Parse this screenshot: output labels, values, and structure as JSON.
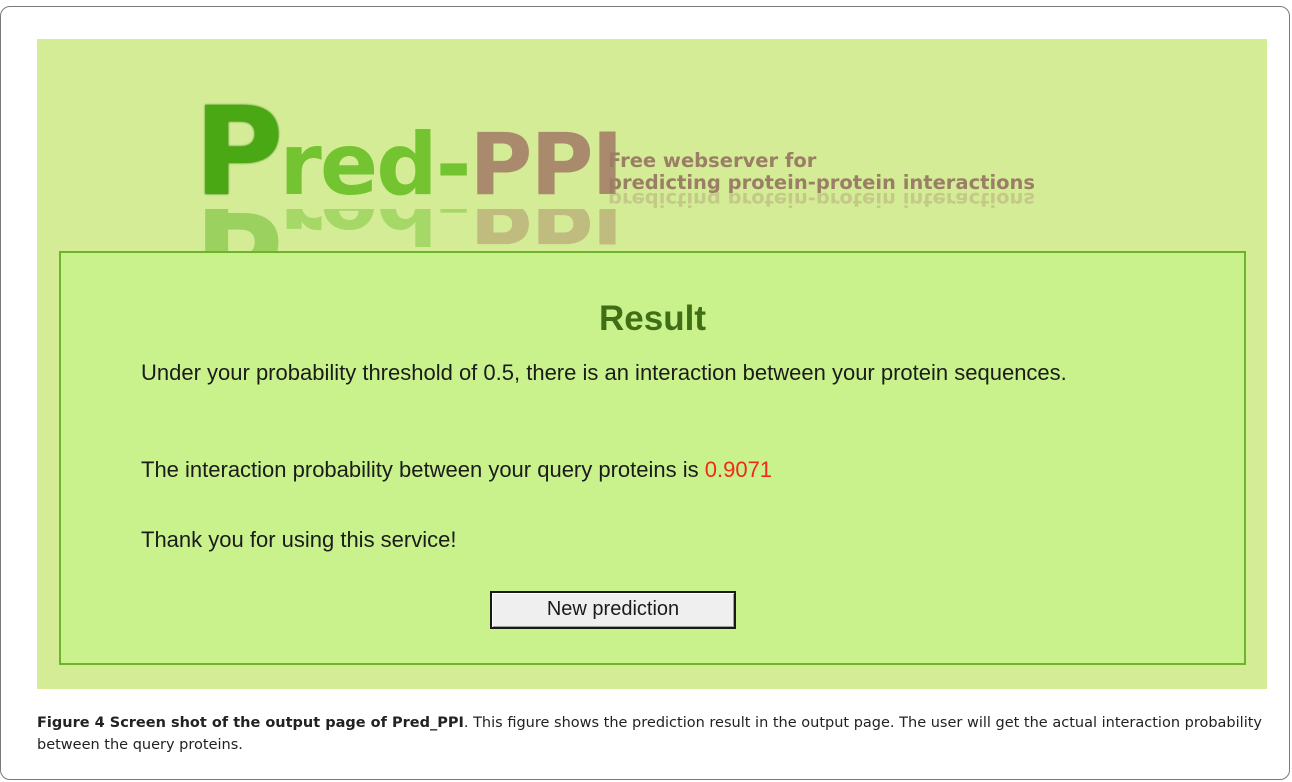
{
  "logo": {
    "p_letter": "P",
    "green_part": "red-",
    "brown_part": "PPI",
    "tagline_line1": "Free webserver for",
    "tagline_line2": "predicting protein-protein interactions"
  },
  "result": {
    "title": "Result",
    "threshold_message": "Under your probability threshold of 0.5, there is an interaction between your protein sequences.",
    "probability_prefix": "The interaction probability between your query proteins is ",
    "probability_value": "0.9071",
    "thanks_message": "Thank you for using this service!",
    "new_prediction_label": "New prediction"
  },
  "colors": {
    "page_background": "#d5ec97",
    "panel_background": "#c9f28c",
    "panel_border": "#6cb52a",
    "title_color": "#3f6e14",
    "probability_color": "#ee2a1c"
  },
  "caption": {
    "label": "Figure 4 Screen shot of the output page of Pred_PPI",
    "text": ". This figure shows the prediction result in the output page. The user will get the actual interaction probability between the query proteins."
  }
}
